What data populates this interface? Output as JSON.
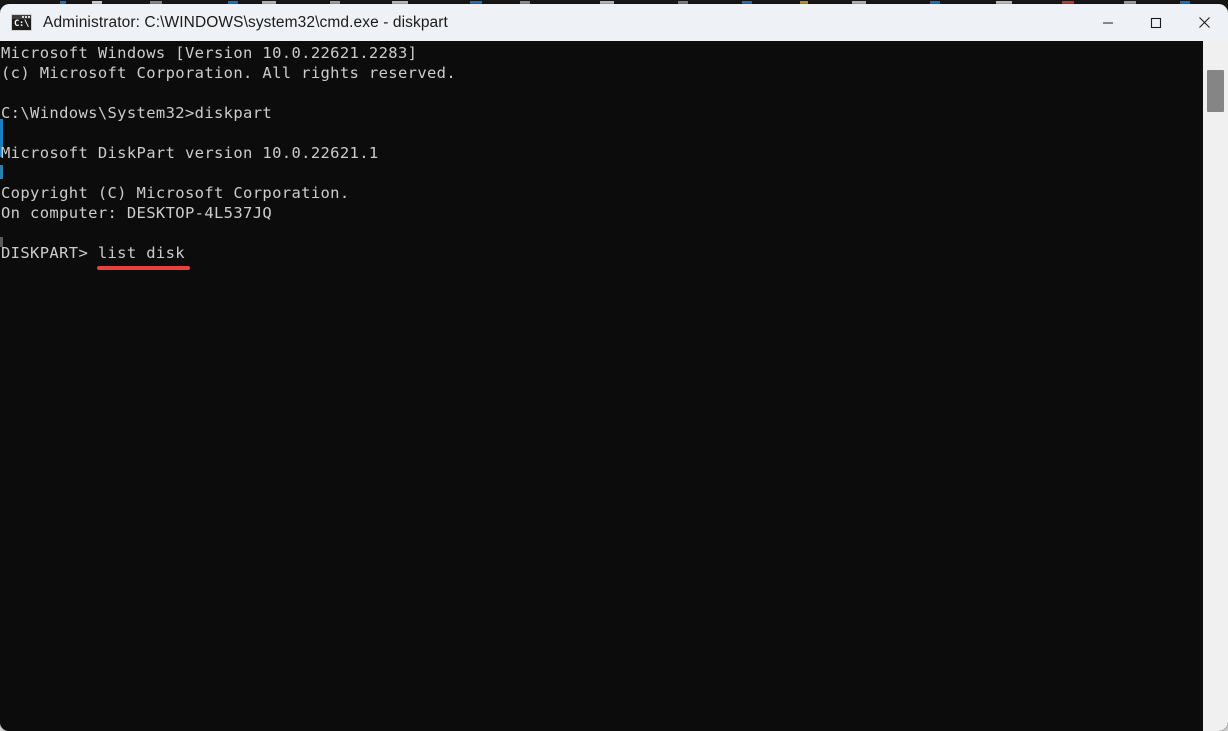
{
  "window": {
    "title": "Administrator: C:\\WINDOWS\\system32\\cmd.exe - diskpart",
    "icon_name": "cmd-exe-icon",
    "icon_text": "C:\\",
    "controls": {
      "minimize_label": "Minimize",
      "maximize_label": "Maximize",
      "close_label": "Close"
    }
  },
  "console": {
    "text": "Microsoft Windows [Version 10.0.22621.2283]\n(c) Microsoft Corporation. All rights reserved.\n\nC:\\Windows\\System32>diskpart\n\nMicrosoft DiskPart version 10.0.22621.1\n\nCopyright (C) Microsoft Corporation.\nOn computer: DESKTOP-4L537JQ\n\nDISKPART> list disk",
    "lines": [
      "Microsoft Windows [Version 10.0.22621.2283]",
      "(c) Microsoft Corporation. All rights reserved.",
      "",
      "C:\\Windows\\System32>diskpart",
      "",
      "Microsoft DiskPart version 10.0.22621.1",
      "",
      "Copyright (C) Microsoft Corporation.",
      "On computer: DESKTOP-4L537JQ",
      "",
      "DISKPART> list disk"
    ],
    "prompt": "DISKPART>",
    "command": "list disk",
    "windows_version": "10.0.22621.2283",
    "diskpart_version": "10.0.22621.1",
    "computer_name": "DESKTOP-4L537JQ",
    "working_directory": "C:\\Windows\\System32",
    "background_color": "#0c0c0c",
    "text_color": "#cccccc"
  },
  "annotation": {
    "type": "underline",
    "target": "list disk",
    "color": "#e8423f"
  },
  "theme": {
    "titlebar_background": "#eef1f6",
    "titlebar_text": "#1b1b1b",
    "scrollbar_track": "#f0f0f0",
    "scrollbar_thumb": "#858585",
    "desktop_background": "#d4d4d4"
  }
}
